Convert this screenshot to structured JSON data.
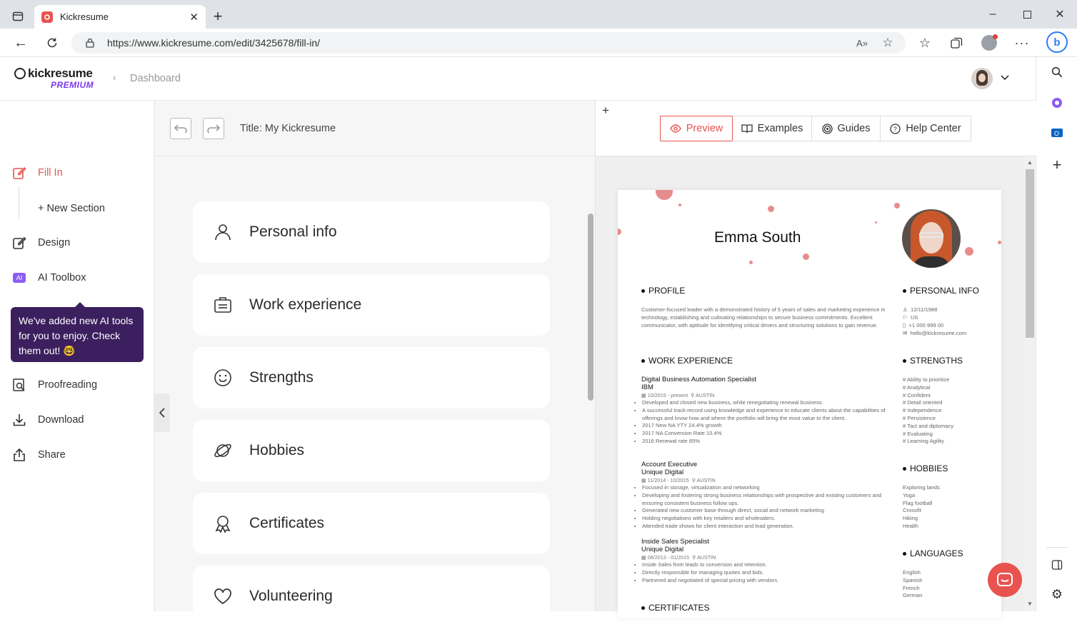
{
  "browser": {
    "tab_title": "Kickresume",
    "url": "https://www.kickresume.com/edit/3425678/fill-in/"
  },
  "header": {
    "logo_text": "kickresume",
    "logo_sub": "PREMIUM",
    "breadcrumb": "Dashboard"
  },
  "nav": {
    "fill_in": "Fill In",
    "new_section": "+ New Section",
    "design": "Design",
    "ai_badge": "AI",
    "ai_toolbox": "AI Toolbox",
    "proofreading": "Proofreading",
    "download": "Download",
    "share": "Share",
    "tooltip": "We've added new AI tools for you to enjoy. Check them out! 🤓"
  },
  "editor": {
    "title": "Title: My Kickresume",
    "sections": [
      "Personal info",
      "Work experience",
      "Strengths",
      "Hobbies",
      "Certificates",
      "Volunteering"
    ]
  },
  "preview_tabs": {
    "preview": "Preview",
    "examples": "Examples",
    "guides": "Guides",
    "help": "Help Center"
  },
  "resume": {
    "name": "Emma South",
    "profile_h": "PROFILE",
    "profile_text": "Customer-focused leader with a demonstrated history of 5 years of sales and marketing experience in technology, establishing and cultivating relationships to secure business commitments. Excellent communicator, with aptitude for identifying critical drivers and structuring solutions to gain revenue.",
    "personal_h": "PERSONAL INFO",
    "personal": [
      "12/11/1988",
      "US",
      "+1 000 999 00",
      "hello@kickresume.com"
    ],
    "work_h": "WORK EXPERIENCE",
    "jobs": [
      {
        "title": "Digital Business Automation Specialist",
        "company": "IBM",
        "dates": "10/2015 - present",
        "place": "AUSTIN",
        "bullets": [
          "Developed and closed new business, while renegotiating renewal business.",
          "A successful track-record using knowledge and experience  to educate clients about the capabilities of offerings and know how and where the portfolio will bring the most value to the client.",
          "2017 New NA YTY 24.4% growth",
          "2017 NA Conversion Rate 10.4%",
          "2016 Renewal rate 85%"
        ]
      },
      {
        "title": "Account Executive",
        "company": "Unique Digital",
        "dates": "11/2014 - 10/2015",
        "place": "AUSTIN",
        "bullets": [
          "Focused in storage, virtualization and networking",
          "Developing and fostering strong business relationships with prospective and existing customers and ensuring consistent business follow ups.",
          "Generated new customer base through direct, social and network marketing",
          "Holding negotiations with key retailers and wholesalers.",
          "Attended trade shows for client interaction and lead generation."
        ]
      },
      {
        "title": "Inside Sales Specialist",
        "company": "Unique Digital",
        "dates": "08/2013 - 01/2015",
        "place": "AUSTIN",
        "bullets": [
          "Inside Sales from leads to conversion and retention.",
          "Directly responsible for managing quotes and bids.",
          "Partnered and negotiated of special pricing with vendors."
        ]
      }
    ],
    "strengths_h": "STRENGTHS",
    "strengths": [
      "# Ability to prioritize",
      "# Analytical",
      "# Confident",
      "# Detail oriented",
      "# Independence",
      "# Persistence",
      "# Tact and diplomacy",
      "# Evaluating",
      "# Learning Agility"
    ],
    "hobbies_h": "HOBBIES",
    "hobbies": [
      "Exploring lands",
      "Yoga",
      "Flag football",
      "Crossfit",
      "Hiking",
      "Health"
    ],
    "languages_h": "LANGUAGES",
    "languages": [
      "English",
      "Spanish",
      "French",
      "German"
    ],
    "certificates_h": "CERTIFICATES"
  },
  "colors": {
    "accent": "#e8534f",
    "tooltip_bg": "#3b1f5e",
    "ai_badge": "#8b5cf6",
    "premium": "#7c3aed"
  }
}
